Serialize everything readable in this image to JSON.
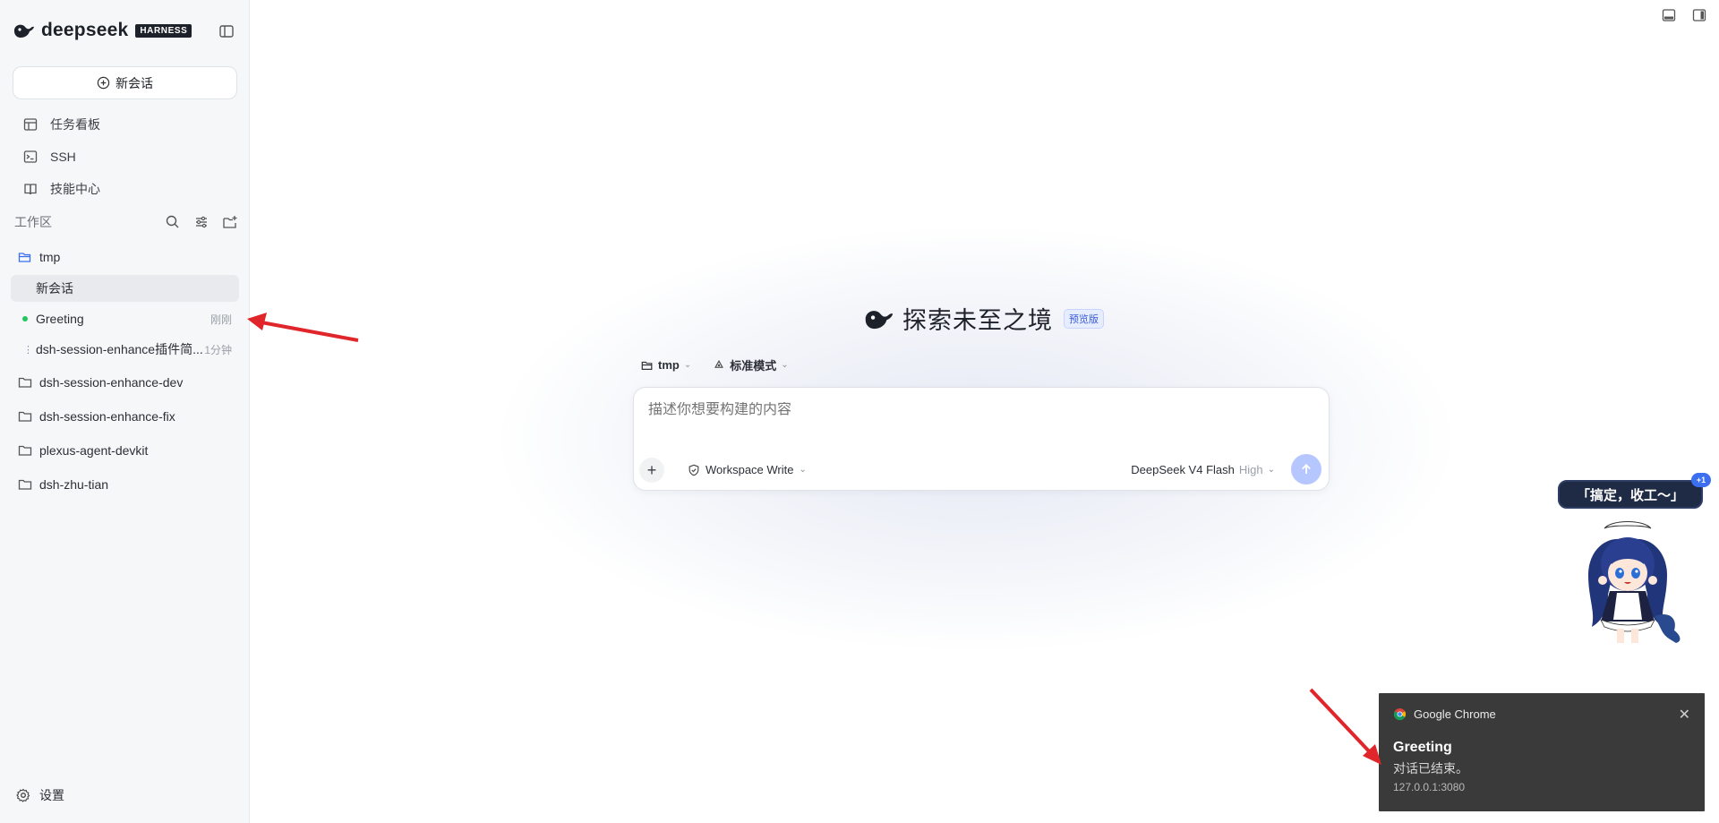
{
  "brand": {
    "name": "deepseek",
    "badge": "HARNESS"
  },
  "sidebar": {
    "new_chat_label": "新会话",
    "nav": [
      {
        "label": "任务看板",
        "icon": "kanban-icon"
      },
      {
        "label": "SSH",
        "icon": "terminal-icon"
      },
      {
        "label": "技能中心",
        "icon": "book-icon"
      }
    ],
    "workspace": {
      "title": "工作区",
      "folders": [
        {
          "name": "tmp",
          "sessions": [
            {
              "label": "新会话",
              "time": "",
              "active": true
            },
            {
              "label": "Greeting",
              "time": "刚刚",
              "status": "green-dot"
            },
            {
              "label": "dsh-session-enhance插件简...",
              "time": "1分钟",
              "status": "dots"
            }
          ]
        },
        {
          "name": "dsh-session-enhance-dev"
        },
        {
          "name": "dsh-session-enhance-fix"
        },
        {
          "name": "plexus-agent-devkit"
        },
        {
          "name": "dsh-zhu-tian"
        }
      ]
    },
    "settings_label": "设置"
  },
  "hero": {
    "title": "探索未至之境",
    "badge": "预览版"
  },
  "composer": {
    "folder": "tmp",
    "mode": "标准模式",
    "placeholder": "描述你想要构建的内容",
    "permission": "Workspace Write",
    "model": "DeepSeek V4 Flash",
    "level": "High"
  },
  "mascot": {
    "speech": "「搞定，收工～」",
    "badge": "+1"
  },
  "notification": {
    "app": "Google Chrome",
    "title": "Greeting",
    "body": "对话已结束。",
    "url": "127.0.0.1:3080"
  },
  "colors": {
    "accent": "#3b6ff0",
    "send_button": "#b6c6ff",
    "arrow": "#e0262b",
    "toast_bg": "#3a3a3a"
  }
}
